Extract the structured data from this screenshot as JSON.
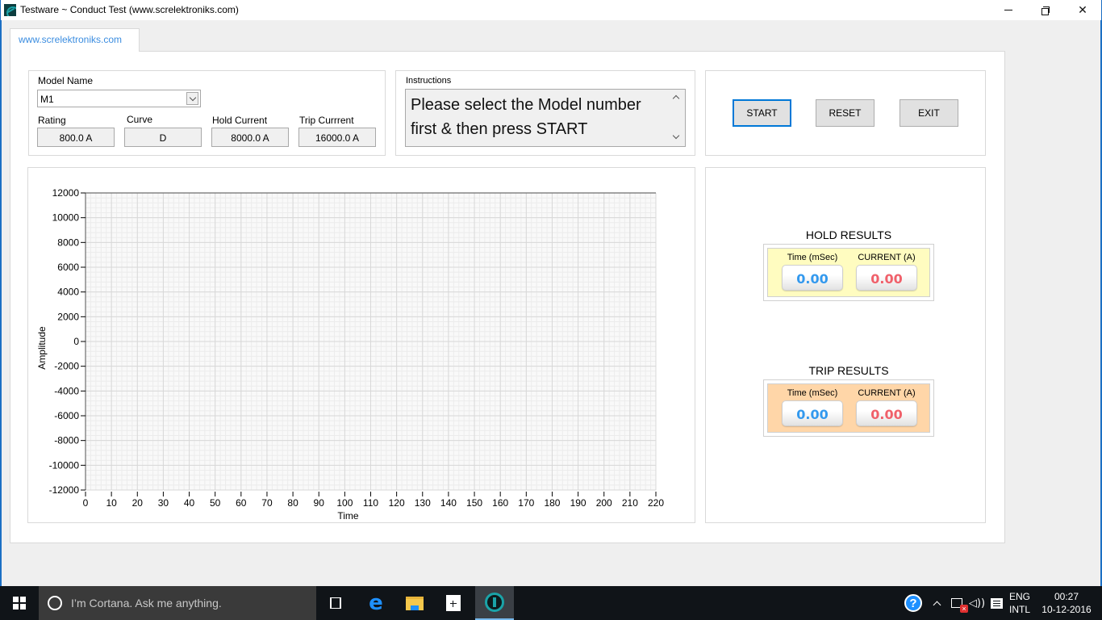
{
  "window": {
    "title": "Testware ~ Conduct Test (www.screlektroniks.com)",
    "controls": {
      "minimize": "minimize",
      "maximize": "restore",
      "close": "close"
    }
  },
  "tab": {
    "label": "www.screlektroniks.com"
  },
  "model": {
    "label": "Model Name",
    "selected": "M1",
    "fields": [
      {
        "label": "Rating",
        "value": "800.0 A"
      },
      {
        "label": "Curve",
        "value": "D"
      },
      {
        "label": "Hold Current",
        "value": "8000.0 A"
      },
      {
        "label": "Trip Currrent",
        "value": "16000.0 A"
      }
    ]
  },
  "instructions": {
    "label": "Instructions",
    "text": "Please select the Model number first & then press START"
  },
  "buttons": {
    "start": "START",
    "reset": "RESET",
    "exit": "EXIT"
  },
  "chart_data": {
    "type": "line",
    "title": "",
    "xlabel": "Time",
    "ylabel": "Amplitude",
    "xlim": [
      0,
      220
    ],
    "ylim": [
      -12000,
      12000
    ],
    "x_ticks": [
      0,
      10,
      20,
      30,
      40,
      50,
      60,
      70,
      80,
      90,
      100,
      110,
      120,
      130,
      140,
      150,
      160,
      170,
      180,
      190,
      200,
      210,
      220
    ],
    "y_ticks": [
      12000,
      10000,
      8000,
      6000,
      4000,
      2000,
      0,
      -2000,
      -4000,
      -6000,
      -8000,
      -10000,
      -12000
    ],
    "grid": true,
    "minor_grid": true,
    "series": []
  },
  "results": {
    "hold": {
      "title": "HOLD RESULTS",
      "time_label": "Time (mSec)",
      "current_label": "CURRENT (A)",
      "time_value": "0.00",
      "current_value": "0.00",
      "background": "#fffcc0"
    },
    "trip": {
      "title": "TRIP RESULTS",
      "time_label": "Time (mSec)",
      "current_label": "CURRENT (A)",
      "time_value": "0.00",
      "current_value": "0.00",
      "background": "#ffd6a8"
    },
    "time_color": "#3399ee",
    "current_color": "#f0606a"
  },
  "taskbar": {
    "search_placeholder": "I’m Cortana. Ask me anything.",
    "pinned": [
      "task-view",
      "edge",
      "file-explorer",
      "store",
      "testware"
    ],
    "language_line1": "ENG",
    "language_line2": "INTL",
    "time": "00:27",
    "date": "10-12-2016"
  }
}
